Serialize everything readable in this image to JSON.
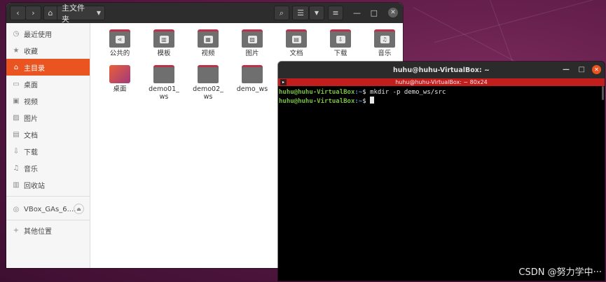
{
  "files": {
    "path_label": "主文件夹",
    "sidebar": [
      {
        "icon": "clock-icon",
        "glyph": "◷",
        "label": "最近使用"
      },
      {
        "icon": "star-icon",
        "glyph": "★",
        "label": "收藏"
      },
      {
        "icon": "home-icon",
        "glyph": "⌂",
        "label": "主目录",
        "active": true
      },
      {
        "icon": "desktop-icon",
        "glyph": "▭",
        "label": "桌面"
      },
      {
        "icon": "video-icon",
        "glyph": "▣",
        "label": "视频"
      },
      {
        "icon": "picture-icon",
        "glyph": "▨",
        "label": "图片"
      },
      {
        "icon": "document-icon",
        "glyph": "▤",
        "label": "文档"
      },
      {
        "icon": "download-icon",
        "glyph": "⇩",
        "label": "下载"
      },
      {
        "icon": "music-icon",
        "glyph": "♫",
        "label": "音乐"
      },
      {
        "icon": "trash-icon",
        "glyph": "🗑",
        "label": "回收站"
      }
    ],
    "device": {
      "icon": "disc-icon",
      "glyph": "◎",
      "label": "VBox_GAs_6...."
    },
    "other": {
      "icon": "plus-icon",
      "glyph": "+",
      "label": "其他位置"
    },
    "items": [
      {
        "name": "公共的",
        "glyph": "⋖",
        "icon": "share-icon",
        "kind": "folder"
      },
      {
        "name": "模板",
        "glyph": "▥",
        "icon": "template-icon",
        "kind": "folder"
      },
      {
        "name": "视频",
        "glyph": "▦",
        "icon": "video-icon",
        "kind": "folder"
      },
      {
        "name": "图片",
        "glyph": "▨",
        "icon": "picture-icon",
        "kind": "folder"
      },
      {
        "name": "文档",
        "glyph": "▤",
        "icon": "document-icon",
        "kind": "folder"
      },
      {
        "name": "下载",
        "glyph": "⇩",
        "icon": "download-icon",
        "kind": "folder"
      },
      {
        "name": "音乐",
        "glyph": "♫",
        "icon": "music-icon",
        "kind": "folder"
      },
      {
        "name": "桌面",
        "glyph": "",
        "icon": "desktop-folder-icon",
        "kind": "desktop"
      },
      {
        "name": "demo01_\nws",
        "glyph": "",
        "icon": "folder-icon",
        "kind": "folder"
      },
      {
        "name": "demo02_\nws",
        "glyph": "",
        "icon": "folder-icon",
        "kind": "folder"
      },
      {
        "name": "demo_ws",
        "glyph": "",
        "icon": "folder-icon",
        "kind": "folder"
      }
    ]
  },
  "terminal": {
    "title": "huhu@huhu-VirtualBox: ~",
    "subtitle": "huhu@huhu-VirtualBox: ~ 80x24",
    "lines": [
      {
        "user": "huhu@huhu-VirtualBox",
        "path": ":~",
        "sym": "$",
        "cmd": " mkdir -p demo_ws/src"
      },
      {
        "user": "huhu@huhu-VirtualBox",
        "path": ":~",
        "sym": "$",
        "cmd": " "
      }
    ]
  },
  "watermark": "CSDN @努力学中···"
}
